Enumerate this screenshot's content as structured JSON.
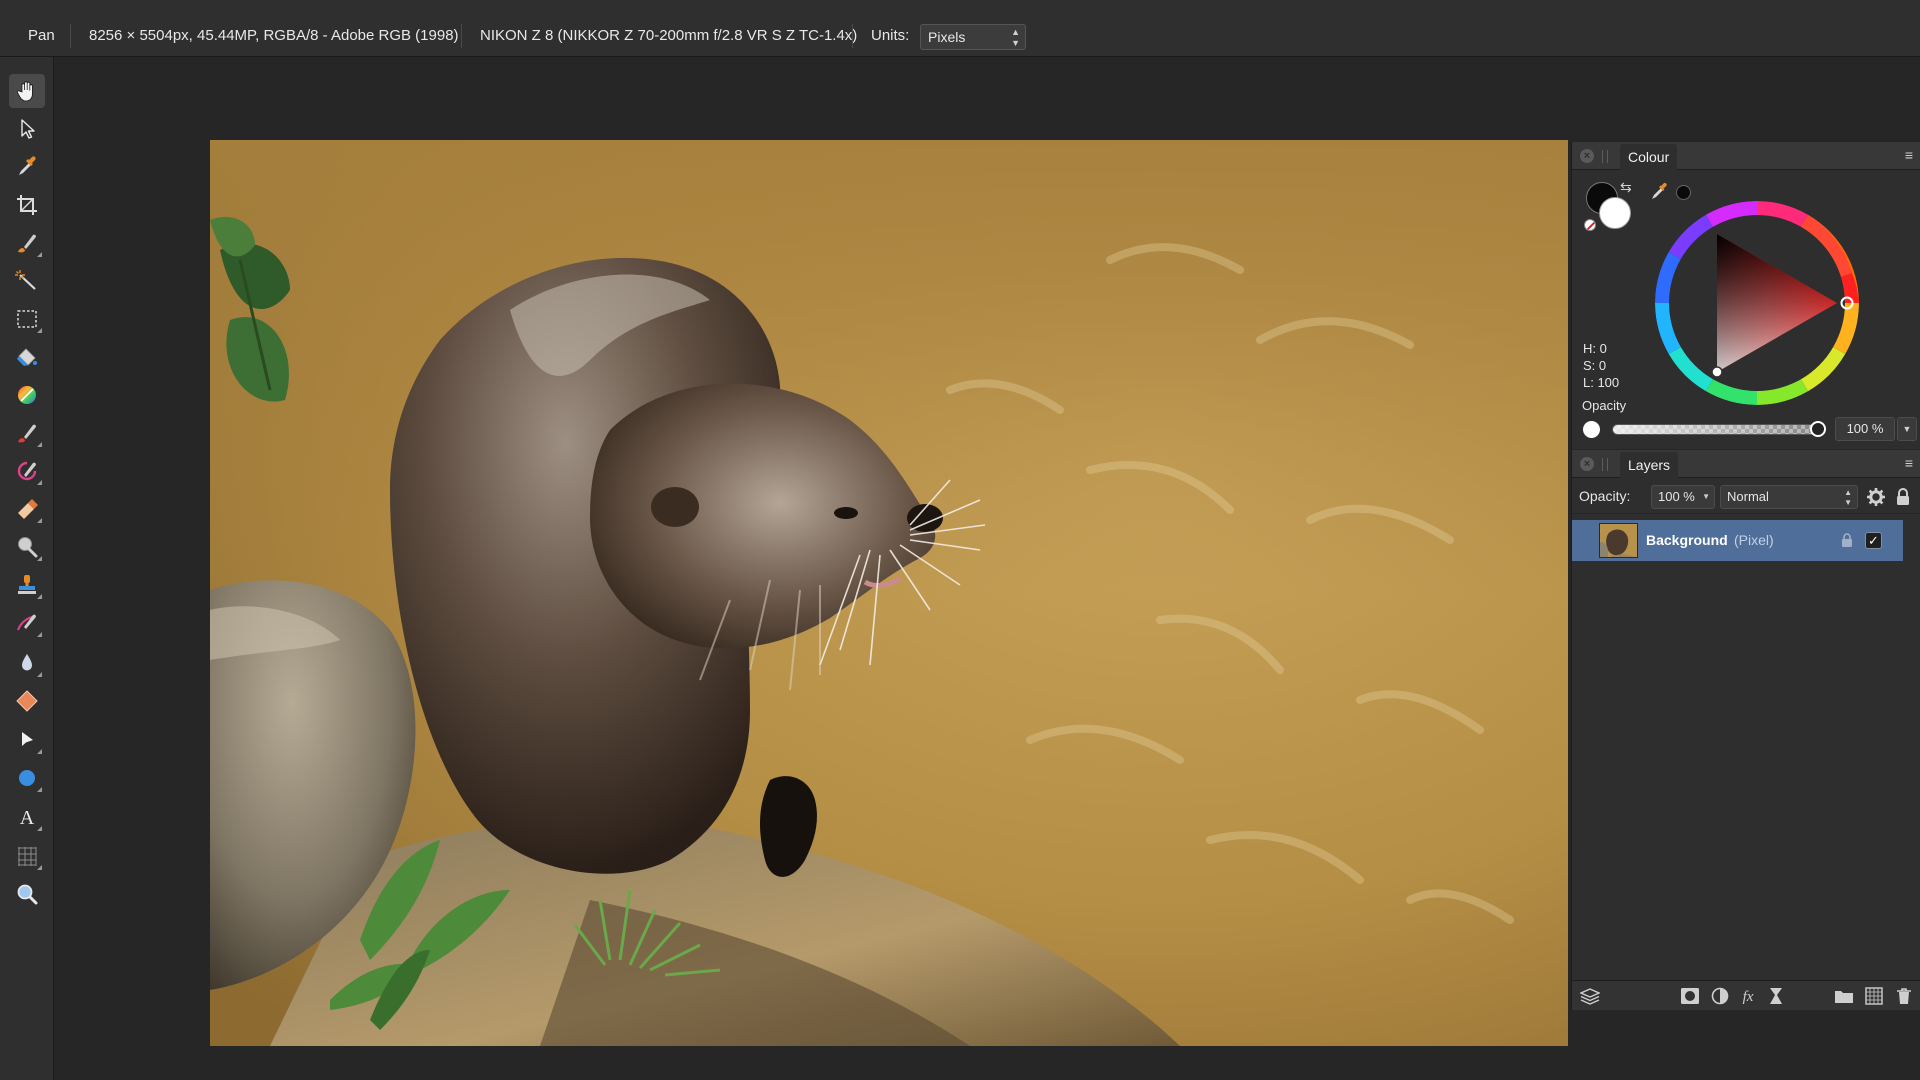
{
  "context_bar": {
    "tool_name": "Pan",
    "doc_info": "8256 × 5504px, 45.44MP, RGBA/8 - Adobe RGB (1998)",
    "camera_info": "NIKON Z 8 (NIKKOR Z 70-200mm f/2.8 VR S Z TC-1.4x)",
    "units_label": "Units:",
    "units_value": "Pixels"
  },
  "tools": [
    {
      "name": "view-tool",
      "icon": "hand-icon",
      "active": true
    },
    {
      "name": "move-tool",
      "icon": "pointer-icon"
    },
    {
      "name": "colour-picker-tool",
      "icon": "eyedropper-icon"
    },
    {
      "name": "crop-tool",
      "icon": "crop-icon"
    },
    {
      "name": "selection-brush-tool",
      "icon": "selection-brush-icon"
    },
    {
      "name": "flood-select-tool",
      "icon": "magic-wand-icon"
    },
    {
      "name": "marquee-tool",
      "icon": "marquee-icon"
    },
    {
      "name": "flood-fill-tool",
      "icon": "paint-bucket-icon"
    },
    {
      "name": "gradient-tool",
      "icon": "gradient-icon"
    },
    {
      "name": "paint-brush-tool",
      "icon": "paint-brush-icon"
    },
    {
      "name": "colour-replacement-tool",
      "icon": "colour-replace-icon"
    },
    {
      "name": "erase-brush-tool",
      "icon": "eraser-icon"
    },
    {
      "name": "dodge-tool",
      "icon": "dodge-icon"
    },
    {
      "name": "clone-tool",
      "icon": "clone-stamp-icon"
    },
    {
      "name": "healing-tool",
      "icon": "healing-icon"
    },
    {
      "name": "blur-tool",
      "icon": "blur-drop-icon"
    },
    {
      "name": "sharpen-tool",
      "icon": "diamond-icon"
    },
    {
      "name": "node-tool",
      "icon": "node-arrow-icon"
    },
    {
      "name": "shape-tool",
      "icon": "ellipse-icon"
    },
    {
      "name": "text-tool",
      "icon": "text-icon"
    },
    {
      "name": "mesh-warp-tool",
      "icon": "mesh-icon"
    },
    {
      "name": "zoom-tool",
      "icon": "zoom-icon"
    }
  ],
  "colour_panel": {
    "title": "Colour",
    "h_readout": "H: 0",
    "s_readout": "S: 0",
    "l_readout": "L: 100",
    "opacity_label": "Opacity",
    "opacity_value": "100 %",
    "opacity_fraction": 1.0,
    "foreground_color": "#0a0a0a",
    "background_color": "#ffffff"
  },
  "layers_panel": {
    "title": "Layers",
    "opacity_label": "Opacity:",
    "opacity_value": "100 %",
    "blend_mode": "Normal",
    "layers": [
      {
        "name": "Background",
        "type": "(Pixel)",
        "selected": true,
        "visible": true,
        "locked": true
      }
    ]
  },
  "colors": {
    "accent_selection": "#4f6f9a",
    "panel_bg": "#2e2e2e",
    "app_bg": "#262626"
  }
}
